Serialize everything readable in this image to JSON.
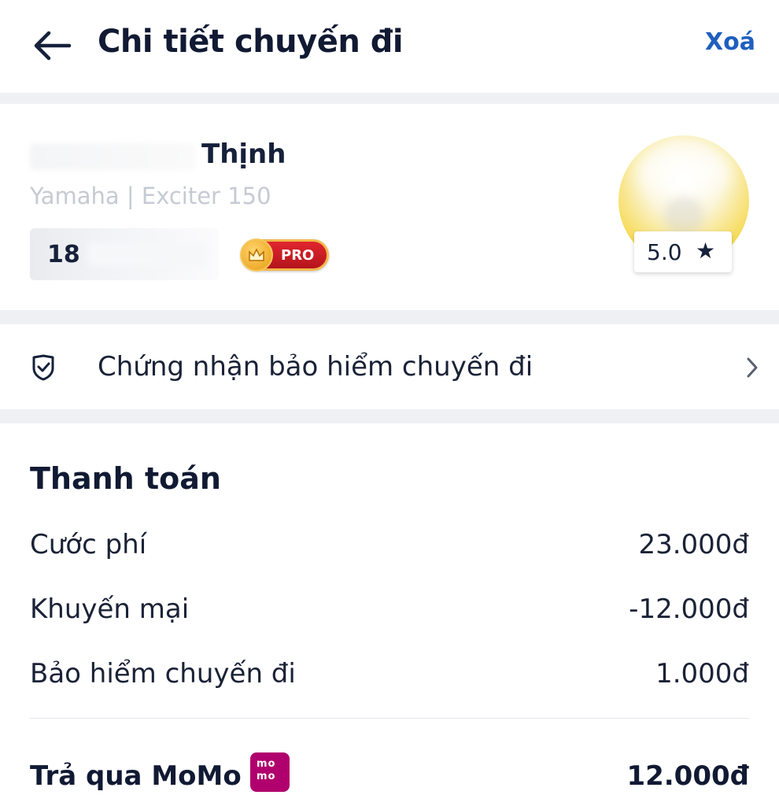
{
  "header": {
    "title": "Chi tiết chuyến đi",
    "delete_label": "Xoá"
  },
  "driver": {
    "name_visible": "Thịnh",
    "vehicle": "Yamaha | Exciter 150",
    "plate_visible": "18",
    "badge": "PRO",
    "rating": "5.0",
    "rating_icon": "star-icon"
  },
  "insurance": {
    "label": "Chứng nhận bảo hiểm chuyến đi",
    "icon": "shield-check-icon"
  },
  "payment": {
    "title": "Thanh toán",
    "rows": [
      {
        "label": "Cước phí",
        "value": "23.000đ"
      },
      {
        "label": "Khuyến mại",
        "value": "-12.000đ"
      },
      {
        "label": "Bảo hiểm chuyến đi",
        "value": "1.000đ"
      }
    ],
    "total_label": "Trả qua MoMo",
    "total_value": "12.000đ",
    "momo_logo_text": [
      "mo",
      "mo"
    ]
  },
  "colors": {
    "accent": "#1f5fbf",
    "text": "#16213a",
    "muted": "#c6cad3",
    "momo": "#b0006d",
    "pro_badge": "#c81b23"
  }
}
